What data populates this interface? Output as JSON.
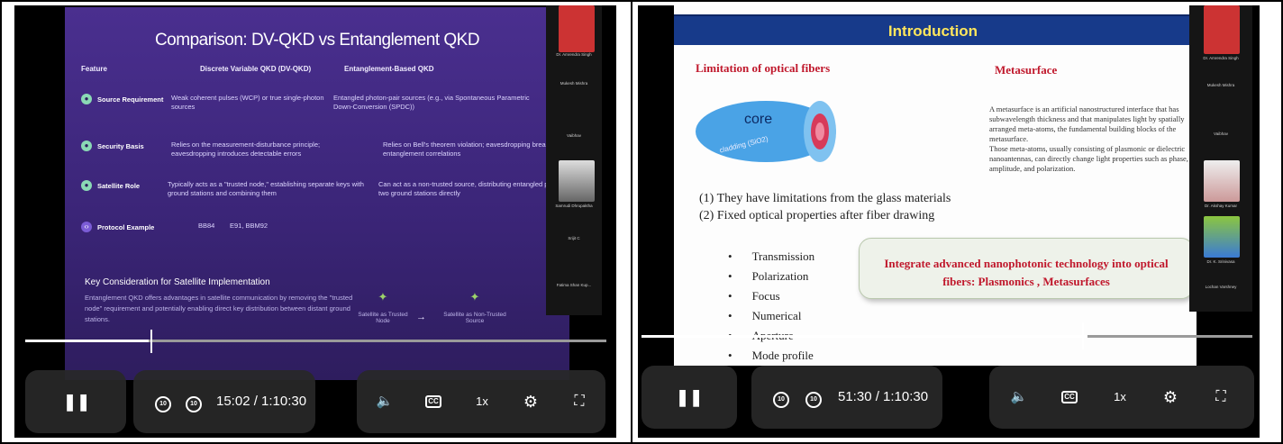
{
  "left_panel": {
    "slide": {
      "title": "Comparison: DV-QKD vs Entanglement QKD",
      "headers": [
        "Feature",
        "Discrete Variable QKD (DV-QKD)",
        "Entanglement-Based QKD"
      ],
      "rows": [
        {
          "feature": "Source Requirement",
          "dv": "Weak coherent pulses (WCP) or true single-photon sources",
          "ent": "Entangled photon-pair sources (e.g., via Spontaneous Parametric Down-Conversion (SPDC))"
        },
        {
          "feature": "Security Basis",
          "dv": "Relies on the measurement-disturbance principle; eavesdropping introduces detectable errors",
          "ent": "Relies on Bell's theorem violation; eavesdropping breaks entanglement correlations"
        },
        {
          "feature": "Satellite Role",
          "dv": "Typically acts as a \"trusted node,\" establishing separate keys with ground stations and combining them",
          "ent": "Can act as a non-trusted source, distributing entangled pairs to two ground stations directly"
        },
        {
          "feature": "Protocol Example",
          "dv": "BB84",
          "ent": "E91, BBM92"
        }
      ],
      "key_title": "Key Consideration for Satellite Implementation",
      "key_body": "Entanglement QKD offers advantages in satellite communication by removing the \"trusted node\" requirement and potentially enabling direct key distribution between distant ground stations.",
      "sat1": "Satellite as Trusted Node",
      "sat2": "Satellite as Non-Trusted Source"
    },
    "participants": [
      "Dr. Amrendra Singh",
      "Mukesh Mishra",
      "Vaibhav",
      "Samrudi Dhrupaktha",
      "Srijit C",
      "Fatima Shan Kup..."
    ],
    "player": {
      "time": "15:02 / 1:10:30",
      "speed": "1x",
      "cc": "CC",
      "progress": 0.213
    }
  },
  "right_panel": {
    "slide": {
      "title": "Introduction",
      "left_heading": "Limitation of optical fibers",
      "right_heading": "Metasurface",
      "core_label": "core",
      "cladding_label": "cladding (SiO2)",
      "limit1": "(1) They have limitations from the glass materials",
      "limit2": "(2) Fixed optical properties after fiber drawing",
      "bullets": [
        "Transmission",
        "Polarization",
        "Focus",
        "Numerical",
        "Aperture",
        "Mode profile"
      ],
      "meta_p1": "A metasurface is an artificial nanostructured interface that has subwavelength thickness and that manipulates light by spatially arranged meta-atoms, the fundamental building blocks of the metasurface.",
      "meta_p2": "Those meta-atoms, usually consisting of plasmonic or dielectric nanoantennas, can directly change light properties such as phase, amplitude, and polarization.",
      "callout_line1": "Integrate advanced nanophotonic technology into optical",
      "callout_line2": "fibers: Plasmonics , Metasurfaces"
    },
    "participants": [
      "Dr. Amrendra Singh",
      "Mukesh Mishra",
      "Vaibhav",
      "Dr. Akshay Kumar",
      "Dr. K. Srinivasa",
      "Lochan Varshney"
    ],
    "player": {
      "time": "51:30 / 1:10:30",
      "speed": "1x",
      "cc": "CC",
      "progress": 0.73
    }
  },
  "icons": {
    "pause": "pause-icon",
    "rewind": "rewind-10-icon",
    "forward": "forward-10-icon",
    "volume": "volume-icon",
    "cc": "closed-captions-icon",
    "settings": "gear-icon",
    "fullscreen": "fullscreen-icon"
  },
  "colors": {
    "slide_purple": "#3b2578",
    "intro_bar": "#173a8a",
    "intro_title": "#ffe65c",
    "red_heading": "#c0182c",
    "control_pill": "#282828"
  }
}
